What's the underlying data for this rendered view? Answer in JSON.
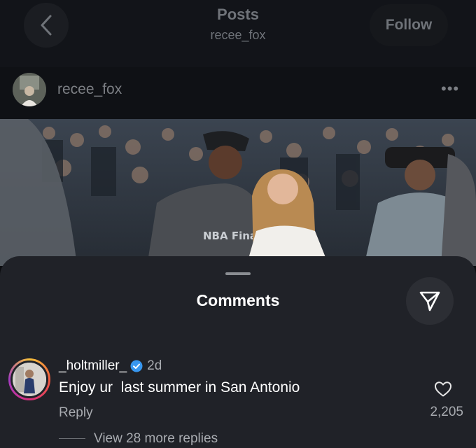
{
  "header": {
    "title": "Posts",
    "subtitle": "recee_fox",
    "follow_label": "Follow"
  },
  "post": {
    "username": "recee_fox",
    "more_icon": "more-horizontal-icon",
    "photo_caption_text": "NBA Finals"
  },
  "comments_sheet": {
    "title": "Comments",
    "share_icon": "send-icon"
  },
  "comment": {
    "username": "_holtmiller_",
    "verified": true,
    "time": "2d",
    "text": "Enjoy ur  last summer in San Antonio",
    "reply_label": "Reply",
    "likes": "2,205",
    "view_replies": "View 28 more replies"
  },
  "colors": {
    "background": "#0c0d10",
    "sheet": "#202228",
    "verified": "#3897f0",
    "muted_text": "#a8abb0"
  }
}
